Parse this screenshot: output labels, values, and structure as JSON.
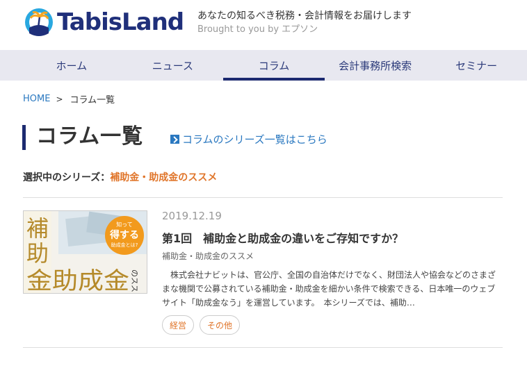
{
  "header": {
    "logo_text": "TabisLand",
    "tagline": "あなたの知るべき税務・会計情報をお届けします",
    "tagline_sub": "Brought to you by エプソン"
  },
  "nav": {
    "items": [
      {
        "label": "ホーム"
      },
      {
        "label": "ニュース"
      },
      {
        "label": "コラム"
      },
      {
        "label": "会計事務所検索"
      },
      {
        "label": "セミナー"
      }
    ],
    "active": "コラム"
  },
  "breadcrumb": {
    "home": "HOME",
    "separator": ">",
    "current": "コラム一覧"
  },
  "page": {
    "title": "コラム一覧",
    "series_link": "コラムのシリーズ一覧はこちら",
    "selected_label": "選択中のシリーズ：",
    "selected_value": "補助金・助成金のススメ"
  },
  "article": {
    "date": "2019.12.19",
    "title": "第1回　補助金と助成金の違いをご存知ですか？",
    "series": "補助金・助成金のススメ",
    "body": "株式会社ナビットは、官公庁、全国の自治体だけでなく、財団法人や協会などのさまざまな機関で公募されている補助金・助成金を細かい条件で検索できる、日本唯一のウェブサイト「助成金なう」を運営しています。　本シリーズでは、補助…",
    "tags": [
      {
        "label": "経営"
      },
      {
        "label": "その他"
      }
    ],
    "thumbnail": {
      "line1": "補",
      "line2": "助",
      "main": "金助成金",
      "suffix": "のススメ",
      "badge_top": "知って",
      "badge_mid": "得する",
      "badge_bottom": "助成金とは?"
    }
  },
  "colors": {
    "brand_navy": "#1c2a70",
    "link_blue": "#2a78c0",
    "accent_orange": "#e0752a",
    "nav_bg": "#e8e8f0"
  }
}
